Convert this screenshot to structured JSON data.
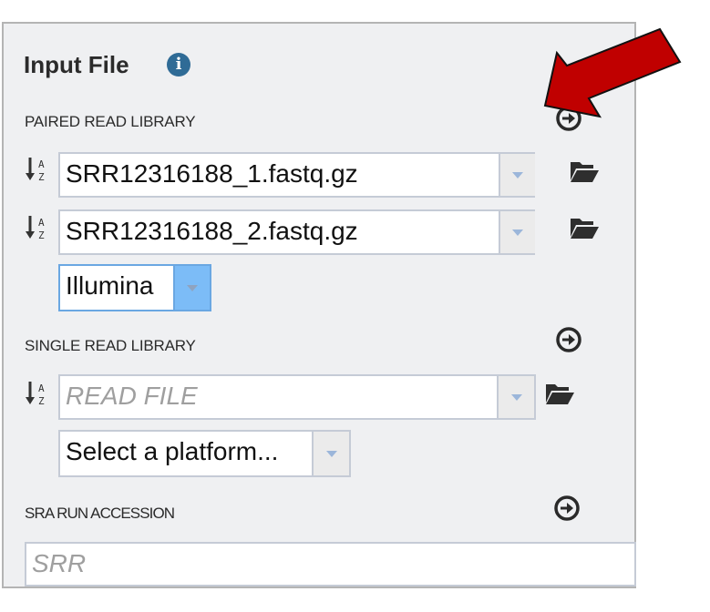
{
  "panel": {
    "title": "Input File",
    "info_icon": "info-circle-icon"
  },
  "paired": {
    "label": "PAIRED READ LIBRARY",
    "read1_value": "SRR12316188_1.fastq.gz",
    "read2_value": "SRR12316188_2.fastq.gz",
    "platform_value": "Illumina"
  },
  "single": {
    "label": "SINGLE READ LIBRARY",
    "read_placeholder": "READ FILE",
    "platform_placeholder": "Select a platform..."
  },
  "sra": {
    "label": "SRA RUN ACCESSION",
    "placeholder": "SRR"
  },
  "icons": {
    "sort": "sort-alpha-down-icon",
    "folder": "folder-open-icon",
    "add": "arrow-circle-right-icon",
    "annotation": "red-pointer-arrow"
  },
  "colors": {
    "panel_bg": "#eff0f2",
    "info_icon": "#2f6b96",
    "active_dropdown": "#7cbcf7",
    "annotation_arrow": "#c00000"
  }
}
